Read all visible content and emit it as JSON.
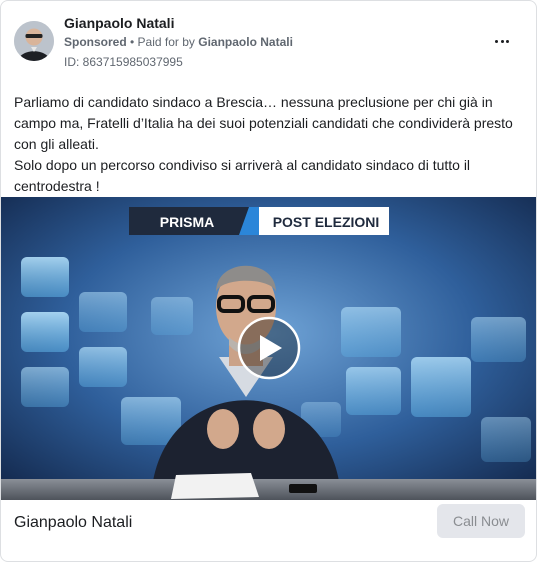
{
  "post": {
    "author": "Gianpaolo Natali",
    "sponsored_label": "Sponsored",
    "separator": " • ",
    "paid_for_prefix": "Paid for by ",
    "paid_for_name": "Gianpaolo Natali",
    "ad_id": "ID: 863715985037995",
    "more_icon": "more-horizontal-icon",
    "text_lines": [
      "Parliamo di candidato sindaco a Brescia… nessuna preclusione per chi già in campo ma, Fratelli d’Italia ha dei suoi potenziali candidati che condividerà presto con gli alleati.",
      "Solo dopo un percorso condiviso si arriverà al candidato sindaco di tutto il centrodestra !"
    ]
  },
  "video": {
    "banner_left": "PRISMA",
    "banner_right": "POST ELEZIONI",
    "play_icon": "play-icon"
  },
  "footer": {
    "page_name": "Gianpaolo Natali",
    "cta_label": "Call Now"
  },
  "colors": {
    "text": "#1c1e21",
    "muted": "#606770",
    "cta_bg": "#e4e6eb",
    "cta_text": "#8a8d91",
    "banner_dark": "#1f2a3d",
    "banner_light": "#ffffff",
    "banner_accent": "#2b86d9"
  }
}
